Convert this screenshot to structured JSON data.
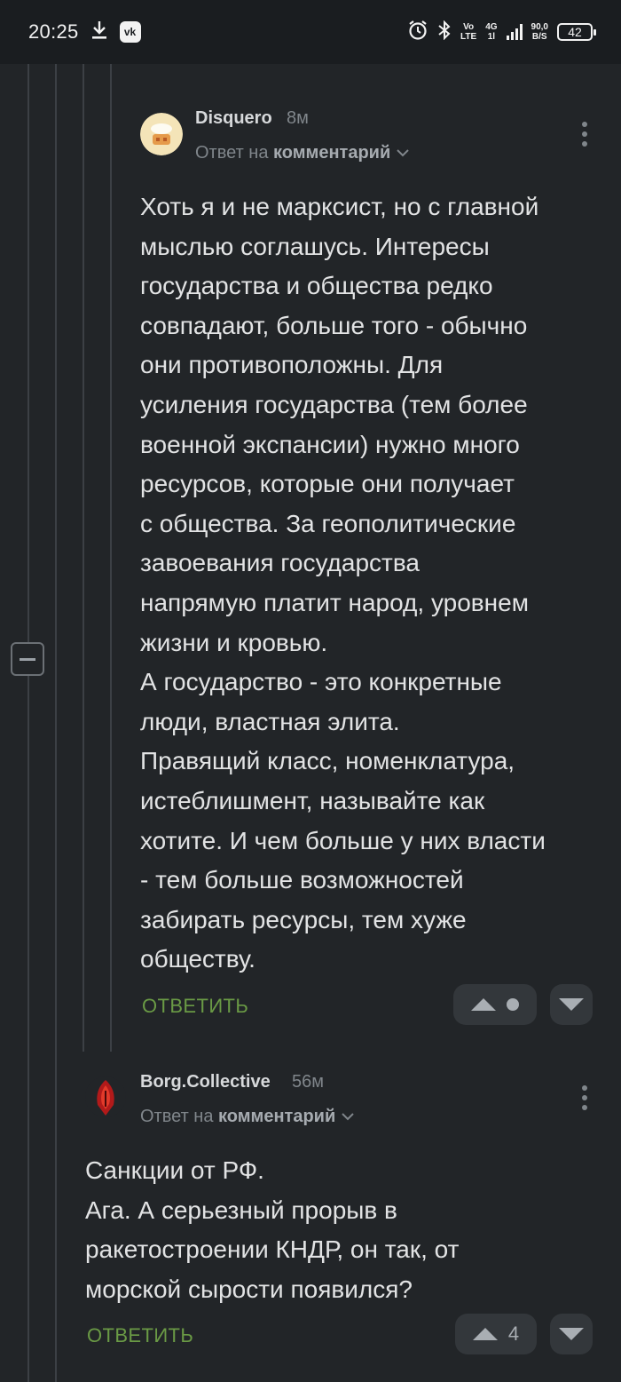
{
  "status_bar": {
    "time": "20:25",
    "vo_lte_top": "Vo",
    "vo_lte_bottom": "LTE",
    "network_top": "4G",
    "network_bottom": "1l",
    "speed_top": "90,0",
    "speed_bottom": "B/S",
    "battery": "42",
    "icons": [
      "download-icon",
      "vk-icon",
      "alarm-icon",
      "bluetooth-icon",
      "signal-icon"
    ]
  },
  "comments": [
    {
      "username": "Disquero",
      "time": "8м",
      "reply_prefix": "Ответ на",
      "reply_target": "комментарий",
      "text": "Хоть я и не марксист, но с главной\nмыслью соглашусь. Интересы\nгосударства и общества редко\nсовпадают, больше того - обычно\nони противоположны. Для\nусиления государства (тем более\nвоенной экспансии) нужно много\nресурсов, которые они получает\nс общества. За геополитические\nзавоевания государства\nнапрямую платит народ, уровнем\nжизни и кровью.\nА государство - это конкретные\nлюди, властная элита.\nПравящий класс, номенклатура,\nистеблишмент, называйте как\nхотите. И чем больше у них власти\n- тем больше возможностей\nзабирать ресурсы, тем хуже\nобществу.",
      "reply_label": "ОТВЕТИТЬ",
      "score": ""
    },
    {
      "username": "Borg.Collective",
      "time": "56м",
      "reply_prefix": "Ответ на",
      "reply_target": "комментарий",
      "text": "Санкции от РФ.\nАга. А серьезный прорыв в\nракетостроении КНДР, он так, от\nморской сырости появился?",
      "reply_label": "ОТВЕТИТЬ",
      "score": "4"
    }
  ],
  "colors": {
    "background": "#222528",
    "reply_green": "#6a9a45",
    "muted": "#80868b"
  }
}
